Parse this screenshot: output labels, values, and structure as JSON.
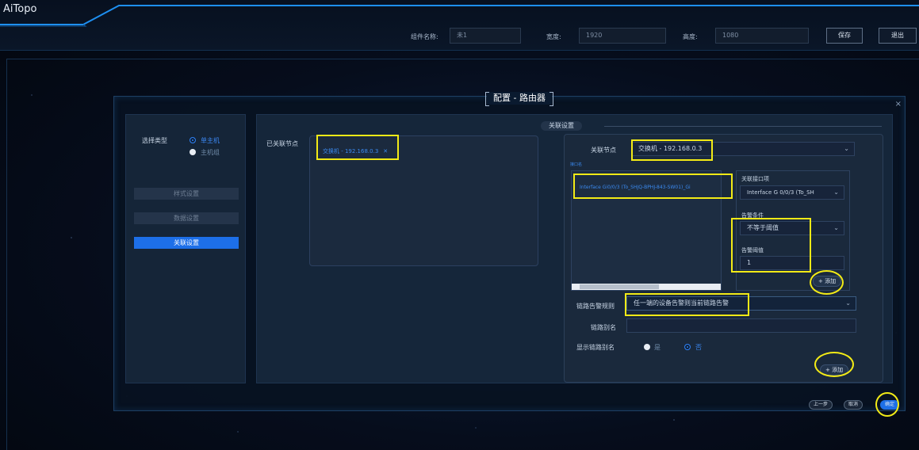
{
  "app": {
    "title": "AiTopo"
  },
  "topbar": {
    "name_label": "组件名称:",
    "name_value": "未1",
    "width_label": "宽度:",
    "width_value": "1920",
    "height_label": "高度:",
    "height_value": "1080",
    "save_label": "保存",
    "exit_label": "退出"
  },
  "dialog": {
    "title": "配置 - 路由器",
    "close_icon": "×",
    "sidebar": {
      "type_label": "选择类型",
      "option_single": "单主机",
      "option_group": "主机组",
      "selected_option": "单主机",
      "menu": [
        {
          "label": "样式设置",
          "active": false
        },
        {
          "label": "数据设置",
          "active": false
        },
        {
          "label": "关联设置",
          "active": true
        }
      ]
    },
    "main": {
      "associated_label": "已关联节点",
      "associated_tag": "交换机 - 192.168.0.3",
      "section_title": "关联设置",
      "node_label": "关联节点",
      "node_value": "交换机 - 192.168.0.3",
      "interface_list_title": "接口名",
      "interface_item": "Interface Gi0/0/3 (To_SHJQ-BPHJ-843-SW01)_Gi",
      "assoc_iface_label": "关联接口项",
      "assoc_iface_value": "Interface G 0/0/3 (To_SH",
      "condition_label": "告警条件",
      "condition_value": "不等于阈值",
      "threshold_label": "告警阈值",
      "threshold_value": "1",
      "add_label": "+ 添加",
      "rule_label": "链路告警规则",
      "rule_value": "任一端的设备告警则当前链路告警",
      "alias_label": "链路别名",
      "alias_value": "",
      "show_alias_label": "显示链路别名",
      "show_yes": "是",
      "show_no": "否",
      "show_selected": "否",
      "add_bottom_label": "+ 添加"
    },
    "footer": {
      "prev_label": "上一步",
      "cancel_label": "取消",
      "confirm_label": "确定"
    }
  },
  "colors": {
    "accent": "#1d6fe8",
    "highlight": "#f2ea16",
    "link": "#3b8af0"
  }
}
